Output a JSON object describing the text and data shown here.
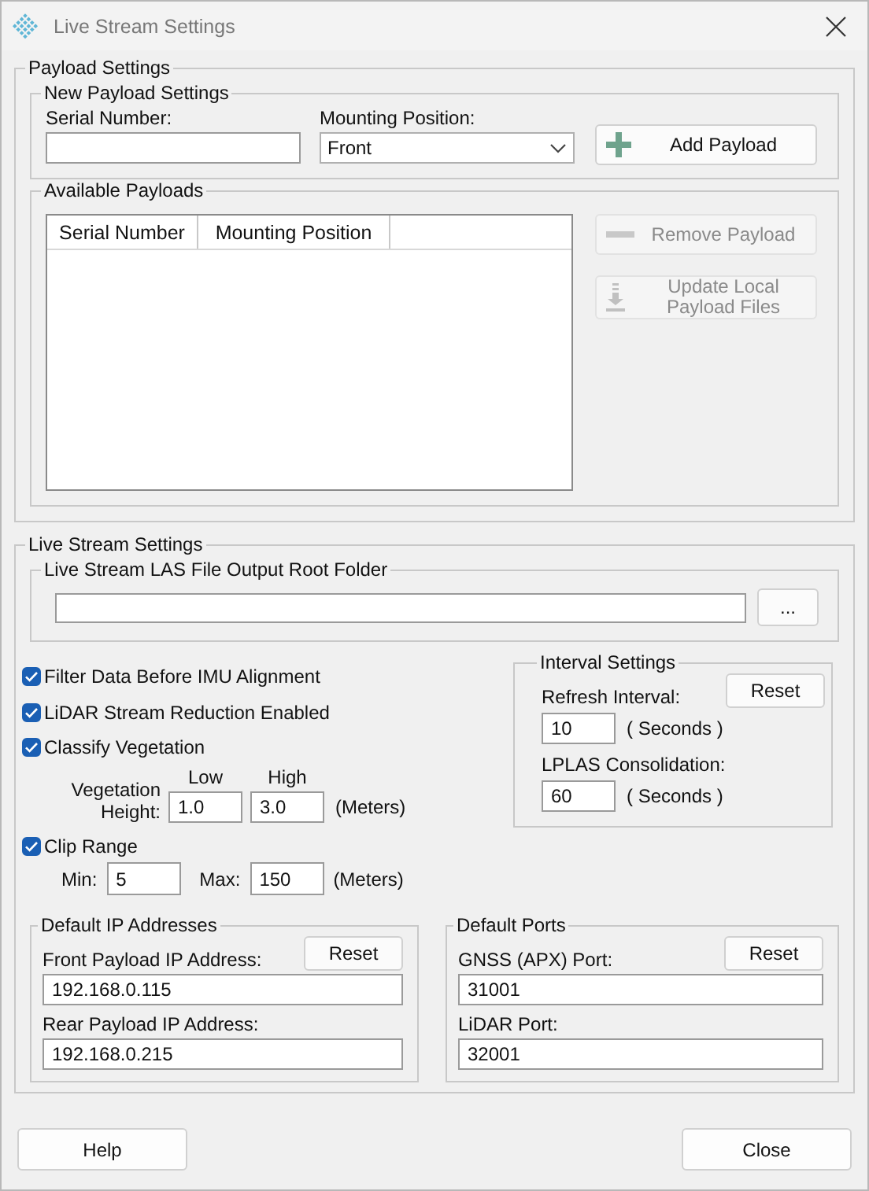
{
  "window": {
    "title": "Live Stream Settings"
  },
  "payload_settings": {
    "title": "Payload Settings",
    "new_payload": {
      "title": "New Payload Settings",
      "serial_label": "Serial Number:",
      "mounting_label": "Mounting Position:",
      "mounting_value": "Front",
      "add_button": {
        "label": "Add Payload",
        "kind": "add",
        "disabled": false
      }
    },
    "available": {
      "title": "Available Payloads",
      "columns": [
        "Serial Number",
        "Mounting Position"
      ],
      "buttons": [
        {
          "label": "Remove Payload",
          "kind": "remove",
          "disabled": true
        },
        {
          "label": "Update Local Payload Files",
          "kind": "update",
          "disabled": true
        }
      ]
    }
  },
  "live_stream": {
    "title": "Live Stream Settings",
    "output_folder": {
      "title": "Live Stream LAS File Output Root Folder",
      "browse_label": "..."
    },
    "checks": [
      {
        "label": "Filter Data Before IMU Alignment",
        "checked": true
      },
      {
        "label": "LiDAR Stream Reduction Enabled",
        "checked": true
      },
      {
        "label": "Classify Vegetation",
        "checked": true
      },
      {
        "label": "Clip Range",
        "checked": true
      }
    ],
    "vegetation": {
      "label": "Vegetation Height:",
      "low_label": "Low",
      "high_label": "High",
      "low": "1.0",
      "high": "3.0",
      "unit": "(Meters)"
    },
    "clip": {
      "min_label": "Min:",
      "min": "5",
      "max_label": "Max:",
      "max": "150",
      "unit": "(Meters)"
    },
    "interval": {
      "title": "Interval Settings",
      "reset": "Reset",
      "refresh_label": "Refresh Interval:",
      "refresh": "10",
      "refresh_unit": "( Seconds )",
      "lplas_label": "LPLAS Consolidation:",
      "lplas": "60",
      "lplas_unit": "( Seconds )"
    },
    "ip": {
      "title": "Default IP Addresses",
      "reset": "Reset",
      "fields": [
        {
          "label": "Front Payload IP Address:",
          "value": "192.168.0.115"
        },
        {
          "label": "Rear Payload IP Address:",
          "value": "192.168.0.215"
        }
      ]
    },
    "ports": {
      "title": "Default Ports",
      "reset": "Reset",
      "fields": [
        {
          "label": "GNSS (APX) Port:",
          "value": "31001"
        },
        {
          "label": "LiDAR Port:",
          "value": "32001"
        }
      ]
    }
  },
  "footer": {
    "buttons": [
      "Help",
      "Close"
    ]
  }
}
